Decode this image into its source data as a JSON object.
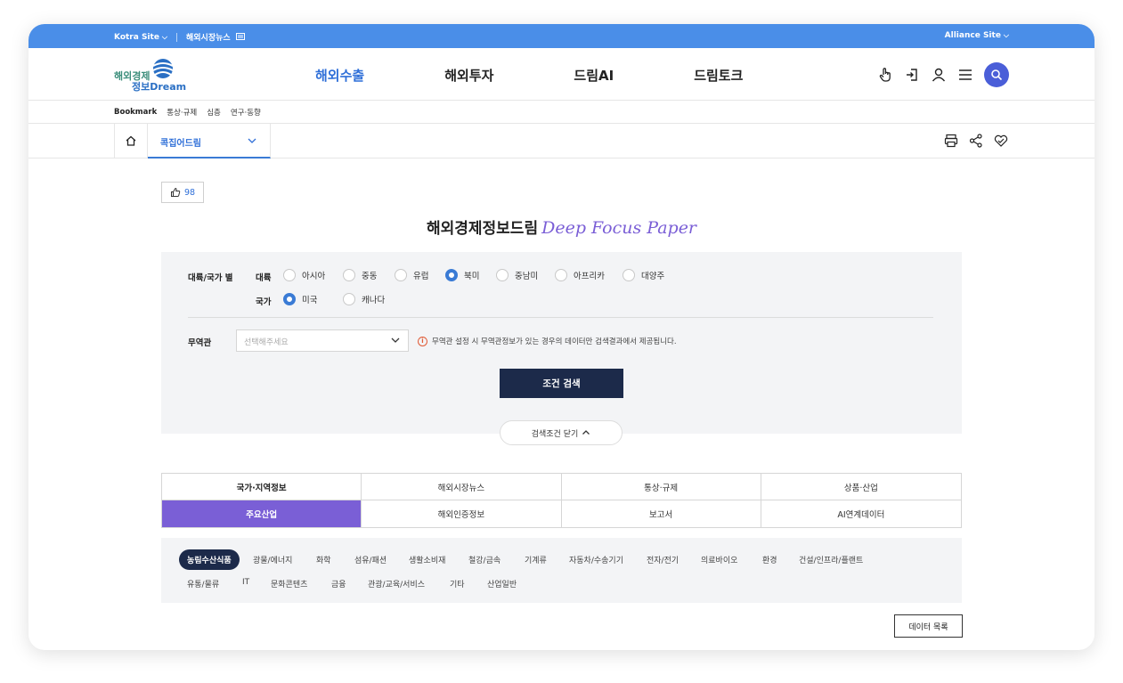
{
  "topbar": {
    "kotra_site": "Kotra Site",
    "market_news": "해외시장뉴스",
    "alliance_site": "Alliance Site"
  },
  "logo": {
    "line1": "해외경제",
    "line2": "정보Dream"
  },
  "gnb": {
    "menu": [
      "해외수출",
      "해외투자",
      "드림AI",
      "드림토크"
    ]
  },
  "bookmark": {
    "label": "Bookmark",
    "items": [
      "통상·규제",
      "심층",
      "연구·동향"
    ]
  },
  "location": {
    "current": "콕집어드림"
  },
  "like": {
    "count": "98"
  },
  "title": {
    "ko": "해외경제정보드림",
    "en": "Deep Focus Paper"
  },
  "conditions": {
    "section_label": "대륙/국가 별",
    "continent_label": "대륙",
    "continents": [
      "아시아",
      "중동",
      "유럽",
      "북미",
      "중남미",
      "아프리카",
      "대양주"
    ],
    "selected_continent": "북미",
    "country_label": "국가",
    "countries": [
      "미국",
      "캐나다"
    ],
    "selected_country": "미국",
    "office_label": "무역관",
    "office_placeholder": "선택해주세요",
    "note": "무역관 설정 시 무역관정보가 있는 경우의 데이터만 검색결과에서 제공됩니다.",
    "search_button": "조건 검색",
    "close_button": "검색조건 닫기"
  },
  "tabs": [
    "국가·지역정보",
    "해외시장뉴스",
    "통상·규제",
    "상품·산업",
    "주요산업",
    "해외인증정보",
    "보고서",
    "AI연계데이터"
  ],
  "active_tab": "주요산업",
  "categories": {
    "row1": [
      "농림수산식품",
      "광물/에너지",
      "화학",
      "섬유/패션",
      "생활소비재",
      "철강/금속",
      "기계류",
      "자동차/수송기기",
      "전자/전기",
      "의료바이오",
      "환경",
      "건설/인프라/플랜트"
    ],
    "row2": [
      "유통/물류",
      "IT",
      "문화콘텐츠",
      "금융",
      "관광/교육/서비스",
      "기타",
      "산업일반"
    ],
    "selected": "농림수산식품"
  },
  "list_button": "데이터 목록",
  "colors": {
    "topbar": "#4a8ee8",
    "accent": "#7a5fd6",
    "navy": "#1c2a4a",
    "blue": "#2f6fd8"
  }
}
